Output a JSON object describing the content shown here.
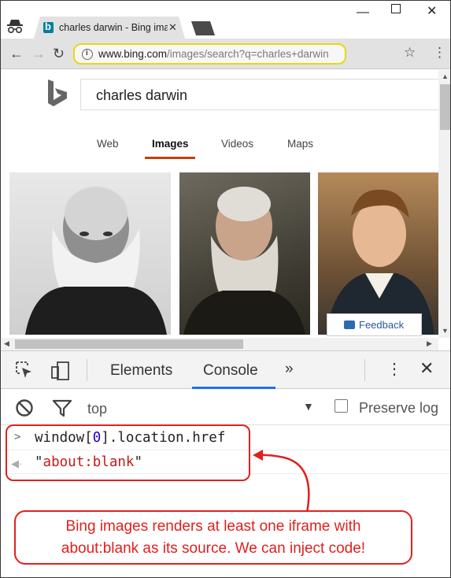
{
  "browser": {
    "tab_title": "charles darwin - Bing ima",
    "url_host": "www.bing.com",
    "url_rest": "/images/search?q=charles+darwin"
  },
  "page": {
    "search_query": "charles darwin",
    "scopes": [
      "Web",
      "Images",
      "Videos",
      "Maps"
    ],
    "active_scope": "Images",
    "feedback_label": "Feedback",
    "accent_color": "#c5410b"
  },
  "devtools": {
    "tabs": [
      "Elements",
      "Console"
    ],
    "active_tab": "Console",
    "context": "top",
    "preserve_log_label": "Preserve log",
    "preserve_log_checked": false,
    "console": {
      "input_prefix": "window[",
      "input_index": "0",
      "input_suffix": "].location.href",
      "output_open_quote": "\"",
      "output_value": "about:blank",
      "output_close_quote": "\""
    }
  },
  "annotation": {
    "line1": "Bing images renders at least one iframe with",
    "line2": "about:blank as its source. We can inject code!",
    "color": "#e0211d"
  }
}
